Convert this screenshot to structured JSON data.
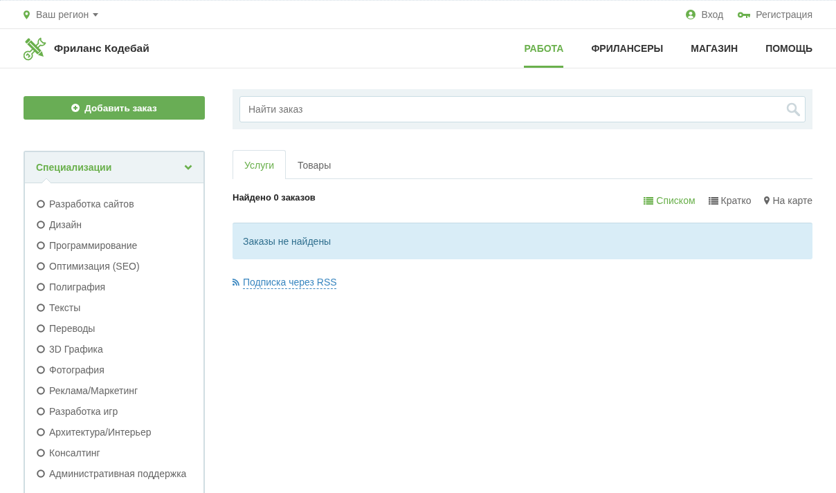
{
  "top_bar": {
    "region": {
      "label": "Ваш регион"
    },
    "links": [
      {
        "kind": "login",
        "label": "Вход"
      },
      {
        "kind": "register",
        "label": "Регистрация"
      }
    ]
  },
  "header": {
    "logo_text": "Фриланс Кодебай",
    "nav": [
      {
        "label": "РАБОТА",
        "selected": true
      },
      {
        "label": "ФРИЛАНСЕРЫ",
        "selected": false
      },
      {
        "label": "МАГАЗИН",
        "selected": false
      },
      {
        "label": "ПОМОЩЬ",
        "selected": false
      }
    ]
  },
  "sidebar": {
    "add_button": "Добавить заказ",
    "specializations": {
      "title": "Специализации",
      "expanded": true,
      "items": [
        {
          "label": "Разработка сайтов",
          "selected": false
        },
        {
          "label": "Дизайн",
          "selected": false
        },
        {
          "label": "Программирование",
          "selected": false
        },
        {
          "label": "Оптимизация (SEO)",
          "selected": false
        },
        {
          "label": "Полиграфия",
          "selected": false
        },
        {
          "label": "Тексты",
          "selected": false
        },
        {
          "label": "Переводы",
          "selected": false
        },
        {
          "label": "3D Графика",
          "selected": false
        },
        {
          "label": "Фотография",
          "selected": false
        },
        {
          "label": "Реклама/Маркетинг",
          "selected": false
        },
        {
          "label": "Разработка игр",
          "selected": false
        },
        {
          "label": "Архитектура/Интерьер",
          "selected": false
        },
        {
          "label": "Консалтинг",
          "selected": false
        },
        {
          "label": "Административная поддержка",
          "selected": false
        }
      ]
    }
  },
  "search": {
    "placeholder": "Найти заказ"
  },
  "tabs": [
    {
      "label": "Услуги",
      "selected": true
    },
    {
      "label": "Товары",
      "selected": false
    }
  ],
  "results": {
    "count_text": "Найдено 0 заказов",
    "view_options": [
      {
        "kind": "list",
        "label": "Списком",
        "selected": true
      },
      {
        "kind": "brief",
        "label": "Кратко",
        "selected": false
      },
      {
        "kind": "map",
        "label": "На карте",
        "selected": false
      }
    ],
    "empty_message": "Заказы не найдены",
    "rss_link": "Подписка через RSS"
  }
}
